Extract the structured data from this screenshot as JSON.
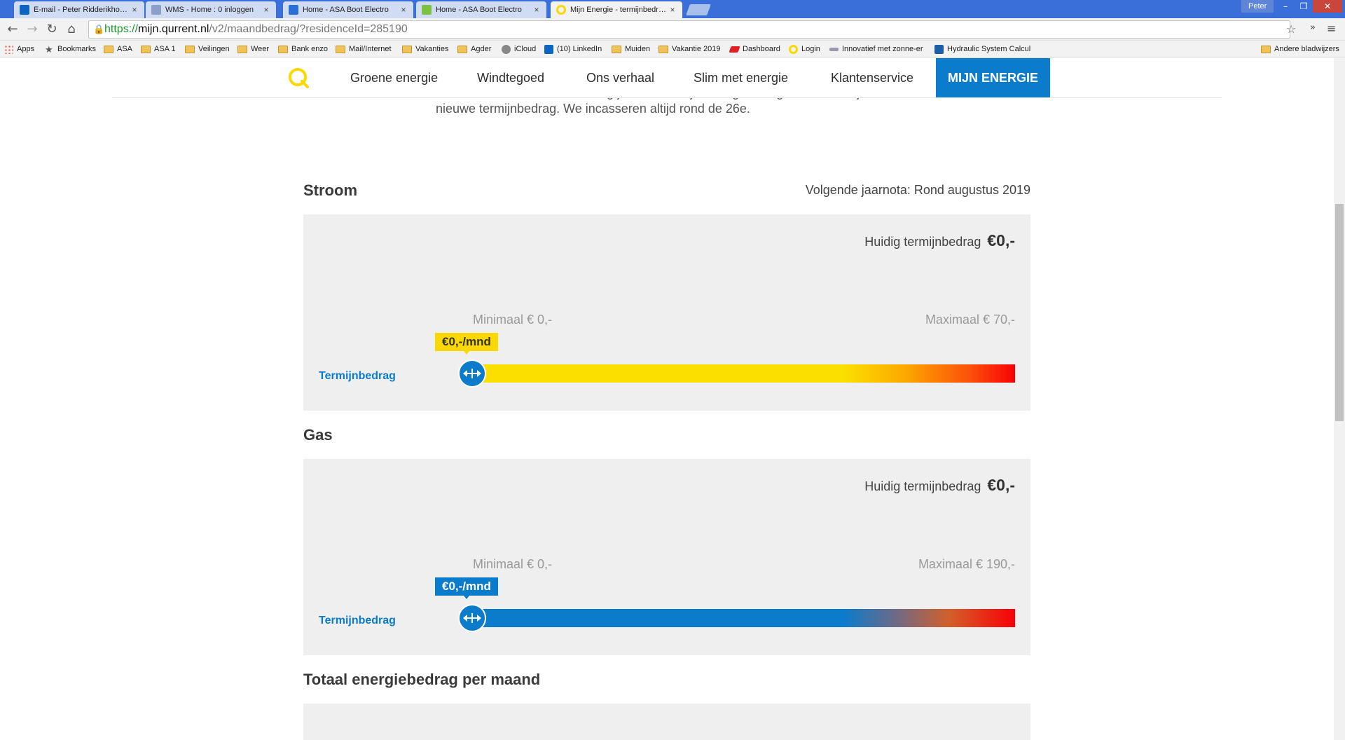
{
  "browser": {
    "tabs": [
      {
        "title": "E-mail - Peter Ridderikhof - O",
        "icon": "outlook-icon",
        "color": "#0a64c0",
        "active": false
      },
      {
        "title": "WMS - Home : 0 inloggen",
        "icon": "wms-icon",
        "color": "#8aa0c8",
        "active": false
      },
      {
        "title": "Home - ASA Boot Electro",
        "icon": "asa-icon",
        "color": "#2a6fd6",
        "active": false
      },
      {
        "title": "Home - ASA Boot Electro",
        "icon": "asa-green-icon",
        "color": "#7cc242",
        "active": false
      },
      {
        "title": "Mijn Energie - termijnbedrag",
        "icon": "qurrent-icon",
        "color": "#fbd800",
        "active": true
      }
    ],
    "close_glyph": "×",
    "user": "Peter",
    "window_buttons": {
      "minimize": "–",
      "restore": "❐",
      "close": "✕"
    },
    "url": {
      "scheme": "https://",
      "host": "mijn.qurrent.nl",
      "path": "/v2/maandbedrag/?residenceId=285190"
    },
    "bookmarks": [
      {
        "label": "Apps",
        "type": "apps"
      },
      {
        "label": "Bookmarks",
        "type": "star"
      },
      {
        "label": "ASA",
        "type": "folder"
      },
      {
        "label": "ASA 1",
        "type": "folder"
      },
      {
        "label": "Veilingen",
        "type": "folder"
      },
      {
        "label": "Weer",
        "type": "folder"
      },
      {
        "label": "Bank enzo",
        "type": "folder"
      },
      {
        "label": "Mail/Internet",
        "type": "folder"
      },
      {
        "label": "Vakanties",
        "type": "folder"
      },
      {
        "label": "Agder",
        "type": "folder"
      },
      {
        "label": "iCloud",
        "type": "apple"
      },
      {
        "label": "(10) LinkedIn",
        "type": "linkedin"
      },
      {
        "label": "Muiden",
        "type": "folder"
      },
      {
        "label": "Vakantie 2019",
        "type": "folder"
      },
      {
        "label": "Dashboard",
        "type": "dashboard"
      },
      {
        "label": "Login",
        "type": "qurrent"
      },
      {
        "label": "Innovatief met zonne-er",
        "type": "solar"
      },
      {
        "label": "Hydraulic System Calcul",
        "type": "hydraulic"
      }
    ],
    "other_bookmarks": "Andere bladwijzers"
  },
  "site": {
    "nav": [
      "Groene energie",
      "Windtegoed",
      "Ons verhaal",
      "Slim met energie",
      "Klantenservice"
    ],
    "nav_active": "MIJN ENERGIE",
    "brand_color": "#0b7ccb",
    "accent_color": "#fbd800"
  },
  "intro": {
    "line1": "incasseren we deze maand nog je oude termijnbedrag en volgende maand je",
    "line2": "nieuwe termijnbedrag. We incasseren altijd rond de 26e."
  },
  "stroom": {
    "title": "Stroom",
    "next_bill": "Volgende jaarnota: Rond augustus 2019",
    "current_label": "Huidig termijnbedrag",
    "current_value": "€0,-",
    "min_label": "Minimaal € 0,-",
    "max_label": "Maximaal € 70,-",
    "bubble": "€0,-/mnd",
    "slider_label": "Termijnbedrag",
    "slider_value": 0,
    "slider_min": 0,
    "slider_max": 70
  },
  "gas": {
    "title": "Gas",
    "current_label": "Huidig termijnbedrag",
    "current_value": "€0,-",
    "min_label": "Minimaal € 0,-",
    "max_label": "Maximaal € 190,-",
    "bubble": "€0,-/mnd",
    "slider_label": "Termijnbedrag",
    "slider_value": 0,
    "slider_min": 0,
    "slider_max": 190
  },
  "totaal": {
    "title": "Totaal energiebedrag per maand"
  }
}
